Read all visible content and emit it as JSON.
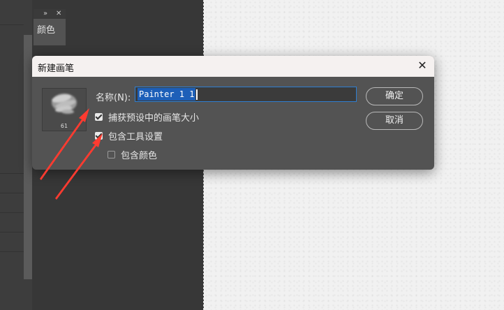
{
  "panel": {
    "title": "颜色"
  },
  "dialog": {
    "title": "新建画笔",
    "name_label": "名称(N):",
    "name_value": "Painter 1 1",
    "thumb_size": "61",
    "options": [
      {
        "label": "捕获预设中的画笔大小",
        "checked": true
      },
      {
        "label": "包含工具设置",
        "checked": true
      },
      {
        "label": "包含颜色",
        "checked": false
      }
    ],
    "ok_label": "确定",
    "cancel_label": "取消"
  },
  "colors": {
    "arrow": "#ff3b30",
    "selection": "#1d5fb8",
    "input_focus": "#2f7fd2"
  },
  "icons": {
    "close": "close-icon",
    "panel_collapse": "double-chevron-icon",
    "panel_close": "close-icon"
  }
}
